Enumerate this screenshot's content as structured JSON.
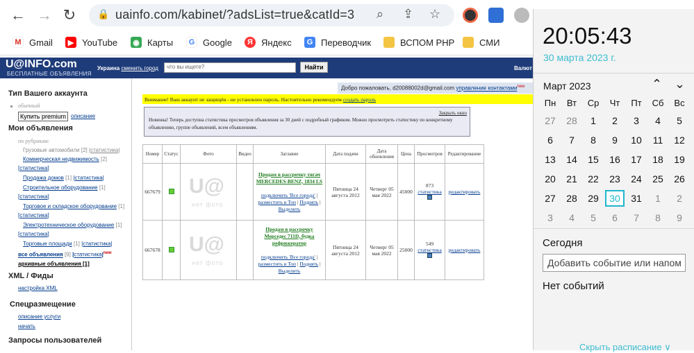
{
  "browser": {
    "url": "uainfo.com/kabinet/?adsList=true&catId=3",
    "bookmarks": [
      {
        "label": "Gmail",
        "icon": "gmail-icon"
      },
      {
        "label": "YouTube",
        "icon": "youtube-icon"
      },
      {
        "label": "Карты",
        "icon": "maps-icon"
      },
      {
        "label": "Google",
        "icon": "google-icon"
      },
      {
        "label": "Яндекс",
        "icon": "yandex-icon"
      },
      {
        "label": "Переводчик",
        "icon": "translate-icon"
      },
      {
        "label": "ВСПОМ РНР",
        "icon": "folder-icon"
      },
      {
        "label": "СМИ",
        "icon": "folder-icon"
      }
    ]
  },
  "site": {
    "logo": "U@INFO.com",
    "logo_sub": "БЕСПЛАТНЫЕ ОБЪЯВЛЕНИЯ",
    "region": "Украина",
    "change_city": "сменить город",
    "search_placeholder": "что вы ищете?",
    "search_button": "Найти",
    "currency": "Валют"
  },
  "sidebar": {
    "account_heading": "Тип Вашего аккаунта",
    "account_type": "обычный",
    "premium_button": "Купить premium",
    "description": "описание",
    "my_ads_heading": "Мои объявления",
    "by_category": "по рубрикам:",
    "categories": [
      {
        "label": "Грузовые автомобили",
        "count": "[2]",
        "stat": "статистика",
        "dim": true
      },
      {
        "label": "Коммерческая недвижимость",
        "count": "[2]",
        "stat": "статистика",
        "dim": false
      },
      {
        "label": "Продажа домов",
        "count": "[1]",
        "stat": "статистика",
        "dim": false
      },
      {
        "label": "Строительное оборудование",
        "count": "[1]",
        "stat": "статистика",
        "dim": false
      },
      {
        "label": "Торговое и складское оборудование",
        "count": "[1]",
        "stat": "статистика",
        "dim": false
      },
      {
        "label": "Электротехническое оборудование",
        "count": "[1]",
        "stat": "статистика",
        "dim": false
      },
      {
        "label": "Торговые площади",
        "count": "[1]",
        "stat": "статистика",
        "dim": false
      }
    ],
    "all_ads": "все объявления",
    "all_ads_count": "[9]",
    "all_ads_stat": "статистика",
    "new_badge": "new",
    "archive_ads": "архивные объявления [1]",
    "xml_heading": "XML / Фиды",
    "xml_settings": "настройка XML",
    "special_heading": "Спецразмещение",
    "service_desc": "описание услуги",
    "start": "начать",
    "requests_heading": "Запросы пользователей"
  },
  "content": {
    "welcome": "Добро пожаловать, d20088002d@gmail.com",
    "manage_contacts": "управление контактами",
    "new_badge": "new",
    "warning": "Внимание! Ваш аккаунт не защищён - не установлен пароль. Настоятельно рекомендуем",
    "warning_link": "создать пароль",
    "notice_close": "Закрыть окно",
    "notice_text": "Новинка! Теперь доступна статистика просмотров объявления за 30 дней с подробный графиком. Можно просмотреть статистику по конкретному объявлению, группе объявлений, всем объявлениям.",
    "columns": [
      "Номер",
      "Статус",
      "Фото",
      "Видео",
      "Заглавие",
      "Дата подачи",
      "Дата обновления",
      "Цена",
      "Просмотров",
      "Редактирование"
    ],
    "photo_placeholder_logo": "U@",
    "photo_placeholder_text": "нет фото",
    "rows": [
      {
        "id": "667679",
        "title": "Продам в рассрочку тягач MERCEDES-BENZ, 1834 LS",
        "connect": "подключить 'Все города'",
        "place_top": "разместить в Топ",
        "raise": "Поднять",
        "highlight": "Выделить",
        "submitted": "Пятница 24 августа 2012",
        "updated": "Четверг 05 мая 2022",
        "price": "45000",
        "views": "873",
        "stat": "статистика",
        "edit": "редактировать"
      },
      {
        "id": "667678",
        "title": "Продам в рассрочку Мерседес 711D, будка рефрижератор",
        "connect": "подключить 'Все города'",
        "place_top": "разместить в Топ",
        "raise": "Поднять",
        "highlight": "Выделить",
        "submitted": "Пятница 24 августа 2012",
        "updated": "Четверг 05 мая 2022",
        "price": "25000",
        "views": "549",
        "stat": "статистика",
        "edit": "редактировать"
      }
    ]
  },
  "clock": {
    "time": "20:05:43",
    "date": "30 марта 2023 г.",
    "month": "Март 2023",
    "weekdays": [
      "Пн",
      "Вт",
      "Ср",
      "Чт",
      "Пт",
      "Сб",
      "Вс"
    ],
    "weeks": [
      [
        "27",
        "28",
        "1",
        "2",
        "3",
        "4",
        "5"
      ],
      [
        "6",
        "7",
        "8",
        "9",
        "10",
        "11",
        "12"
      ],
      [
        "13",
        "14",
        "15",
        "16",
        "17",
        "18",
        "19"
      ],
      [
        "20",
        "21",
        "22",
        "23",
        "24",
        "25",
        "26"
      ],
      [
        "27",
        "28",
        "29",
        "30",
        "31",
        "1",
        "2"
      ],
      [
        "3",
        "4",
        "5",
        "6",
        "7",
        "8",
        "9"
      ]
    ],
    "today_heading": "Сегодня",
    "event_placeholder": "Добавить событие или напом",
    "no_events": "Нет событий",
    "hide_schedule": "Скрыть расписание ∨",
    "accent": "#1fb6ce"
  }
}
